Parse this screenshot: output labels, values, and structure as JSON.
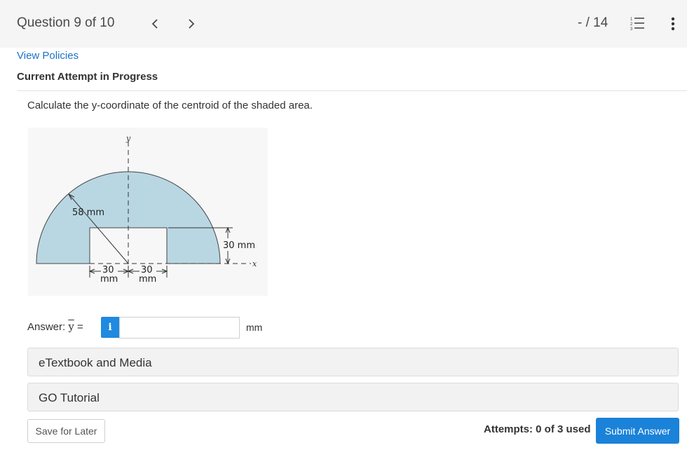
{
  "header": {
    "question_label": "Question 9 of 10",
    "score": "- / 14",
    "icons": [
      "chevron-left-icon",
      "chevron-right-icon",
      "numbered-list-icon",
      "kebab-menu-icon"
    ]
  },
  "links": {
    "view_policies": "View Policies"
  },
  "status": {
    "current_attempt": "Current Attempt in Progress"
  },
  "question": {
    "prompt": "Calculate the y-coordinate of the centroid of the shaded area.",
    "figure": {
      "y_axis": "y",
      "x_axis": "x",
      "radius_label": "58 mm",
      "height_label": "30 mm",
      "width_left_top": "30",
      "width_left_bottom": "mm",
      "width_right_top": "30",
      "width_right_bottom": "mm",
      "shade_color": "#b9d7e3"
    }
  },
  "answer": {
    "label": "Answer: ",
    "symbol": "y",
    "equals": " =",
    "info_glyph": "i",
    "value": "",
    "unit": "mm"
  },
  "panels": {
    "etextbook": "eTextbook and Media",
    "go_tutorial": "GO Tutorial"
  },
  "footer": {
    "save_label": "Save for Later",
    "attempts": "Attempts: 0 of 3 used",
    "submit_label": "Submit Answer"
  },
  "colors": {
    "accent": "#1a82d8",
    "link": "#1a73c8"
  }
}
